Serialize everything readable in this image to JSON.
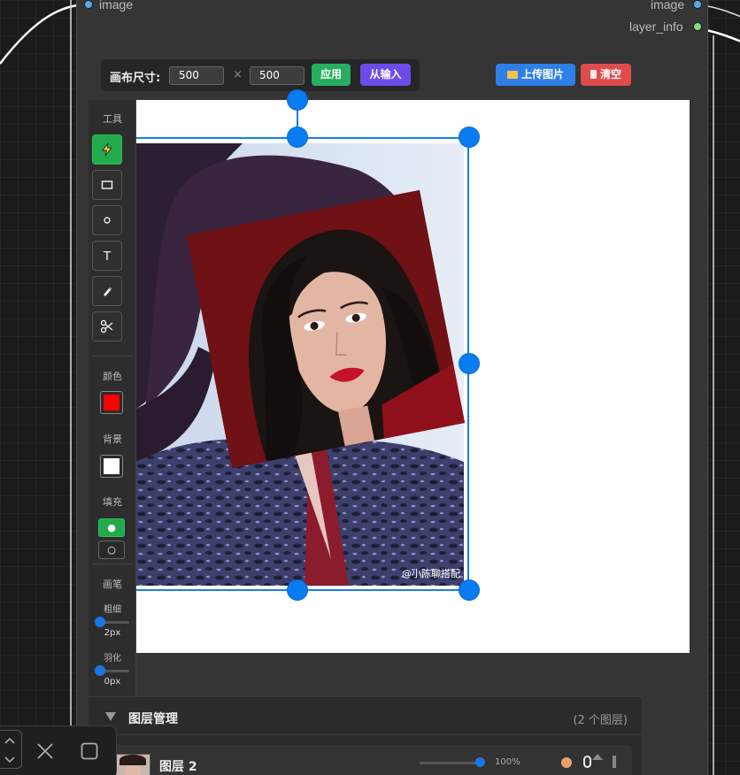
{
  "node": {
    "input_slot": "image",
    "output_slots": [
      "image",
      "layer_info"
    ],
    "colors": {
      "input_dot": "#5aa9e6",
      "output_image_dot": "#5aa9e6",
      "output_info_dot": "#7de07d"
    }
  },
  "toolbar": {
    "canvas_size_label": "画布尺寸:",
    "width_value": "500",
    "height_value": "500",
    "times_symbol": "×",
    "apply_label": "应用",
    "from_input_label": "从输入",
    "upload_label": "上传图片",
    "clear_label": "清空",
    "colors": {
      "apply": "#27ae60",
      "from_input": "#6c4be8",
      "upload": "#2f7fe8",
      "clear": "#e04b4b"
    }
  },
  "sidebar": {
    "tools_label": "工具",
    "tools": [
      {
        "name": "select-tool",
        "icon": "lightning-icon",
        "active": true
      },
      {
        "name": "rectangle-tool",
        "icon": "rectangle-icon"
      },
      {
        "name": "circle-tool",
        "icon": "circle-icon"
      },
      {
        "name": "text-tool",
        "icon": "text-icon",
        "glyph": "T"
      },
      {
        "name": "brush-tool",
        "icon": "brush-icon"
      },
      {
        "name": "cut-tool",
        "icon": "scissors-icon"
      }
    ],
    "color_label": "颜色",
    "color_value": "#ff0000",
    "background_label": "背景",
    "background_value": "#ffffff",
    "fill_label": "填充",
    "brush_label": "画笔",
    "thickness_label": "粗细",
    "thickness_value": "2px",
    "feather_label": "羽化",
    "feather_value": "0px"
  },
  "canvas": {
    "watermark": "@小陈聊搭配"
  },
  "layers": {
    "title": "图层管理",
    "count": "(2 个图层)",
    "items": [
      {
        "name": "图层 2",
        "opacity": "100%"
      }
    ]
  }
}
